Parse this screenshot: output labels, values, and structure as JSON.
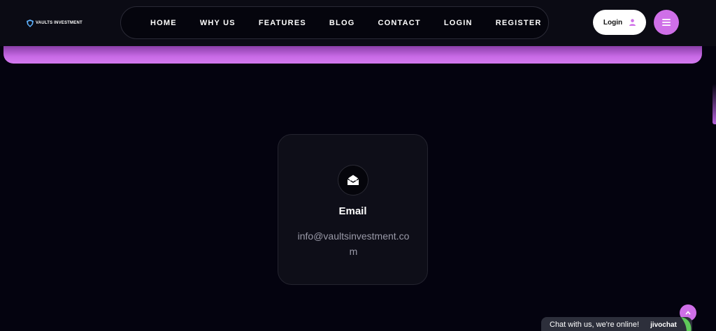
{
  "brand": {
    "name": "VAULTS INVESTMENT",
    "icon": "shield-icon"
  },
  "nav": {
    "items": [
      {
        "label": "HOME"
      },
      {
        "label": "WHY US"
      },
      {
        "label": "FEATURES"
      },
      {
        "label": "BLOG"
      },
      {
        "label": "CONTACT"
      },
      {
        "label": "LOGIN"
      },
      {
        "label": "REGISTER"
      }
    ]
  },
  "header": {
    "login_label": "Login",
    "login_icon": "user-icon",
    "menu_icon": "hamburger-icon"
  },
  "contact_card": {
    "icon": "envelope-open-icon",
    "title": "Email",
    "value": "info@vaultsinvestment.com"
  },
  "chat": {
    "text": "Chat with us, we're online!",
    "brand": "jivochat"
  },
  "colors": {
    "accent": "#cf6fe8",
    "background": "#04030f",
    "card": "#0e0e18"
  }
}
